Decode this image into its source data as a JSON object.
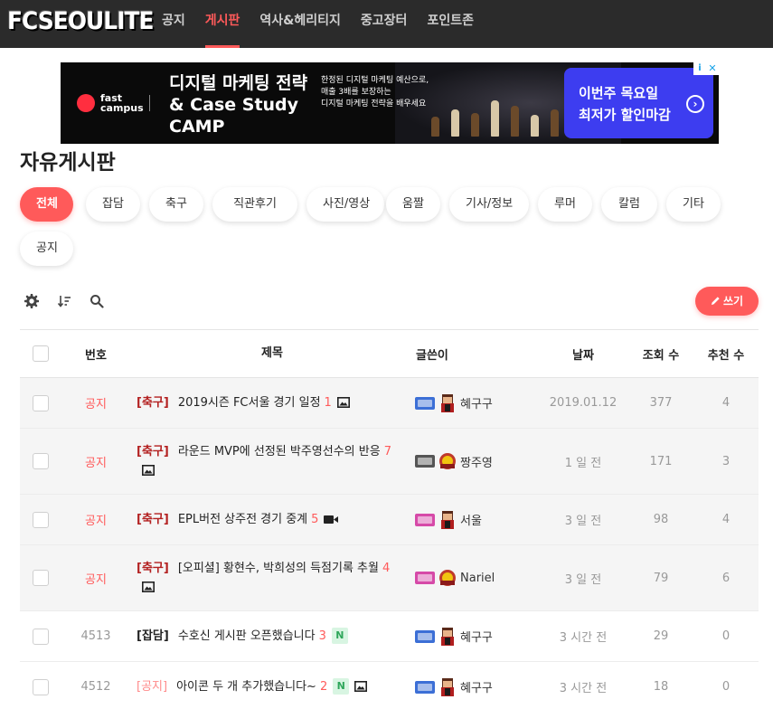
{
  "site": {
    "logo": "FCSEOULITE"
  },
  "nav": [
    {
      "label": "공지",
      "active": false
    },
    {
      "label": "게시판",
      "active": true
    },
    {
      "label": "역사&헤리티지",
      "active": false
    },
    {
      "label": "중고장터",
      "active": false
    },
    {
      "label": "포인트존",
      "active": false
    }
  ],
  "ad": {
    "brand": "fast campus",
    "title": "디지털 마케팅 전략\n& Case Study\nCAMP",
    "description": "한정된 디지털 마케팅 예산으로,\n매출 3배를 보장하는\n디지털 마케팅 전략을 배우세요",
    "cta": "이번주 목요일\n최저가 할인마감"
  },
  "board": {
    "title": "자유게시판",
    "categories": [
      {
        "label": "전체",
        "active": true
      },
      {
        "label": "잡담",
        "active": false
      },
      {
        "label": "축구",
        "active": false
      },
      {
        "label": "직관후기",
        "active": false
      },
      {
        "label": "사진/영상",
        "active": false
      },
      {
        "label": "움짤",
        "active": false
      },
      {
        "label": "기사/정보",
        "active": false
      },
      {
        "label": "루머",
        "active": false
      },
      {
        "label": "칼럼",
        "active": false
      },
      {
        "label": "기타",
        "active": false
      },
      {
        "label": "공지",
        "active": false
      }
    ],
    "write_label": "쓰기",
    "columns": {
      "num": "번호",
      "title": "제목",
      "author": "글쓴이",
      "date": "날짜",
      "views": "조회 수",
      "recommend": "추천 수"
    },
    "rows": [
      {
        "num": "공지",
        "notice": true,
        "tag": "[축구]",
        "title": "2019시즌 FC서울 경기 일정",
        "comments": "1",
        "icons": [
          "image-icon"
        ],
        "author": "혜구구",
        "level": "blue",
        "date": "2019.01.12",
        "views": "377",
        "recommend": "4"
      },
      {
        "num": "공지",
        "notice": true,
        "tag": "[축구]",
        "title": "라운드 MVP에 선정된 박주영선수의 반응",
        "comments": "7",
        "icons": [
          "image-icon"
        ],
        "author": "짱주영",
        "level": "gray",
        "date": "1 일 전",
        "views": "171",
        "recommend": "3"
      },
      {
        "num": "공지",
        "notice": true,
        "tag": "[축구]",
        "title": "EPL버전 상주전 경기 중계",
        "comments": "5",
        "icons": [
          "video-icon"
        ],
        "author": "서울",
        "level": "pink",
        "date": "3 일 전",
        "views": "98",
        "recommend": "4"
      },
      {
        "num": "공지",
        "notice": true,
        "tag": "[축구]",
        "title": "[오피셜] 황현수, 박희성의 득점기록 추월",
        "comments": "4",
        "icons": [
          "image-icon"
        ],
        "author": "Nariel",
        "level": "pink",
        "date": "3 일 전",
        "views": "79",
        "recommend": "6"
      },
      {
        "num": "4513",
        "notice": false,
        "tag": "[잡담]",
        "title": "수호신 게시판 오픈했습니다",
        "comments": "3",
        "icons": [
          "new-badge"
        ],
        "author": "혜구구",
        "level": "blue",
        "date": "3 시간 전",
        "views": "29",
        "recommend": "0"
      },
      {
        "num": "4512",
        "notice": false,
        "tag": "[공지]",
        "title": "아이콘 두 개 추가했습니다~",
        "comments": "2",
        "icons": [
          "new-badge",
          "image-icon"
        ],
        "author": "혜구구",
        "level": "blue",
        "date": "3 시간 전",
        "views": "18",
        "recommend": "0"
      }
    ],
    "new_badge": "N"
  }
}
